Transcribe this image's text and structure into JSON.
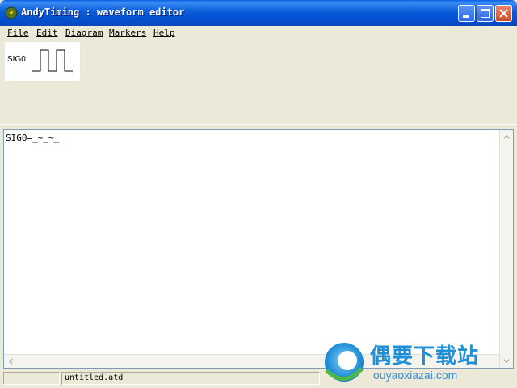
{
  "window": {
    "title": "AndyTiming : waveform editor",
    "icon": "app-lightning-icon"
  },
  "menu": {
    "items": [
      {
        "label": "File"
      },
      {
        "label": "Edit"
      },
      {
        "label": "Diagram"
      },
      {
        "label": "Markers"
      },
      {
        "label": "Help"
      }
    ]
  },
  "diagram": {
    "signal_name": "SIG0",
    "waveform": "_~_~_"
  },
  "editor": {
    "text": "SIG0=_~_~_"
  },
  "statusbar": {
    "left": "",
    "filename": "untitled.atd"
  },
  "watermark": {
    "title": "偶要下载站",
    "subtitle": "ouyaoxiazai.com"
  },
  "colors": {
    "titlebar": "#0a5fe0",
    "chrome": "#ece9d8",
    "watermark": "#1f8fd6"
  }
}
